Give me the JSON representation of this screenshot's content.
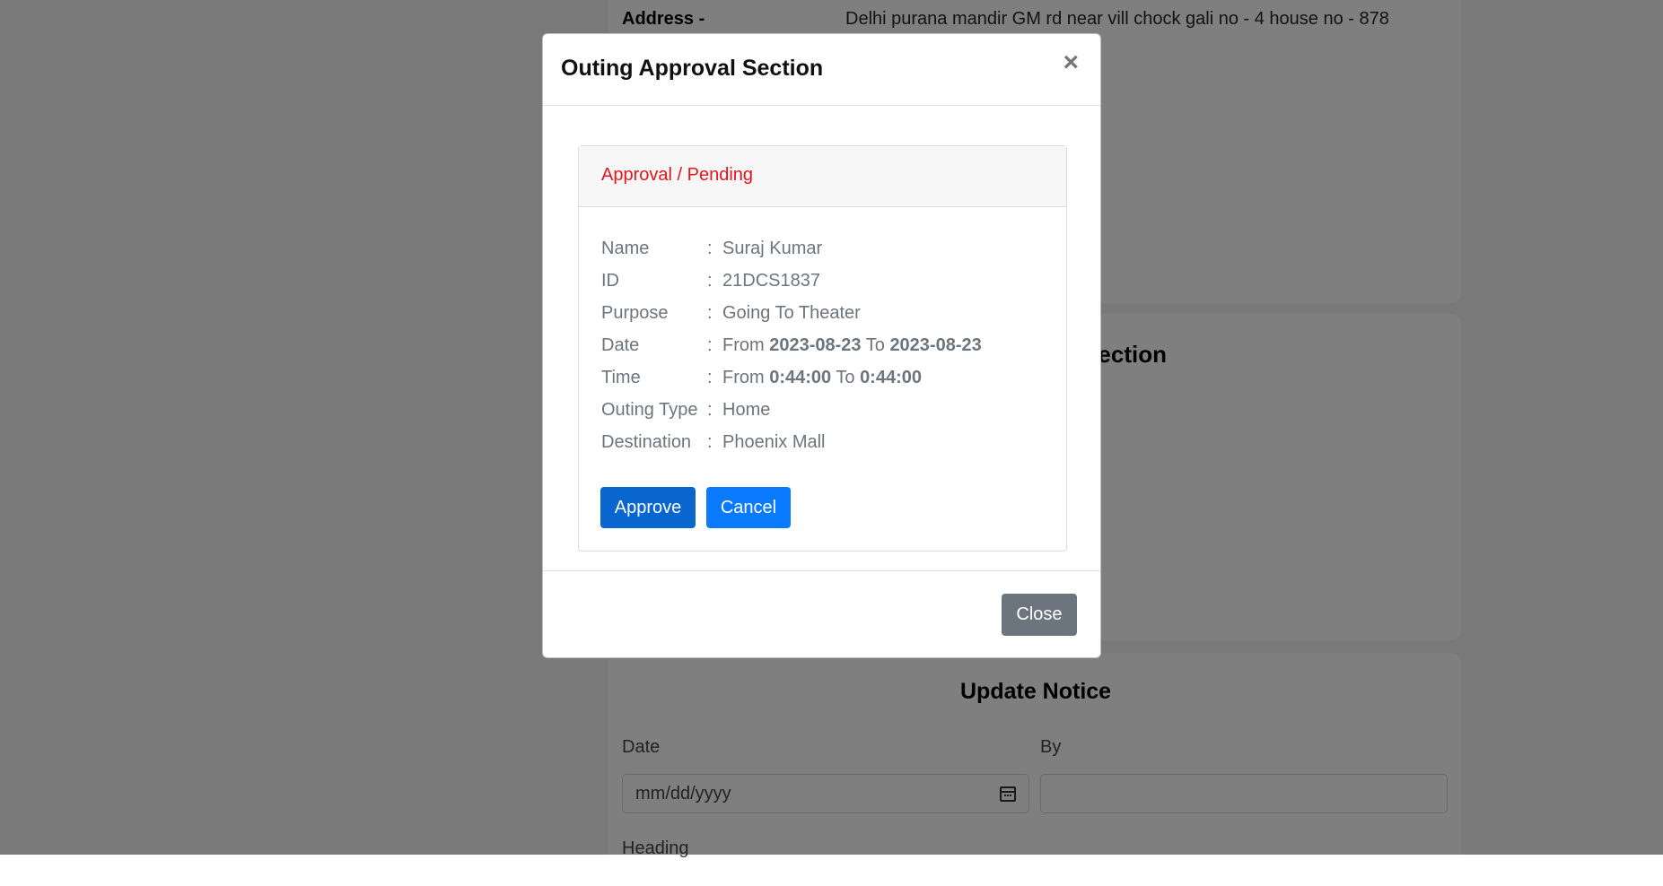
{
  "background": {
    "address_label": "Address -",
    "address_value": "Delhi purana mandir GM rd near vill chock gali no - 4 house no - 878",
    "section2_title_fragment": "ection",
    "notice": {
      "title": "Update Notice",
      "date_label": "Date",
      "date_placeholder": "mm/dd/yyyy",
      "by_label": "By",
      "by_value": "",
      "heading_label": "Heading"
    }
  },
  "modal": {
    "title": "Outing Approval Section",
    "close_x": "×",
    "card_header": "Approval / Pending",
    "fields": {
      "name_label": "Name",
      "name_value": "Suraj Kumar",
      "id_label": "ID",
      "id_value": "21DCS1837",
      "purpose_label": "Purpose",
      "purpose_value": "Going To Theater",
      "date_label": "Date",
      "from_word": "From",
      "to_word": "To",
      "date_from": "2023-08-23",
      "date_to": "2023-08-23",
      "time_label": "Time",
      "time_from": "0:44:00",
      "time_to": "0:44:00",
      "outing_type_label": "Outing Type",
      "outing_type_value": "Home",
      "destination_label": "Destination",
      "destination_value": "Phoenix Mall",
      "separator": ":"
    },
    "approve_label": "Approve",
    "cancel_label": "Cancel",
    "close_label": "Close"
  },
  "colors": {
    "pending_text": "#e5161b",
    "approve_button": "#0966cf",
    "cancel_button": "#0a7bff",
    "close_button": "#6c757d",
    "backdrop": "rgba(0,0,0,0.5)"
  }
}
